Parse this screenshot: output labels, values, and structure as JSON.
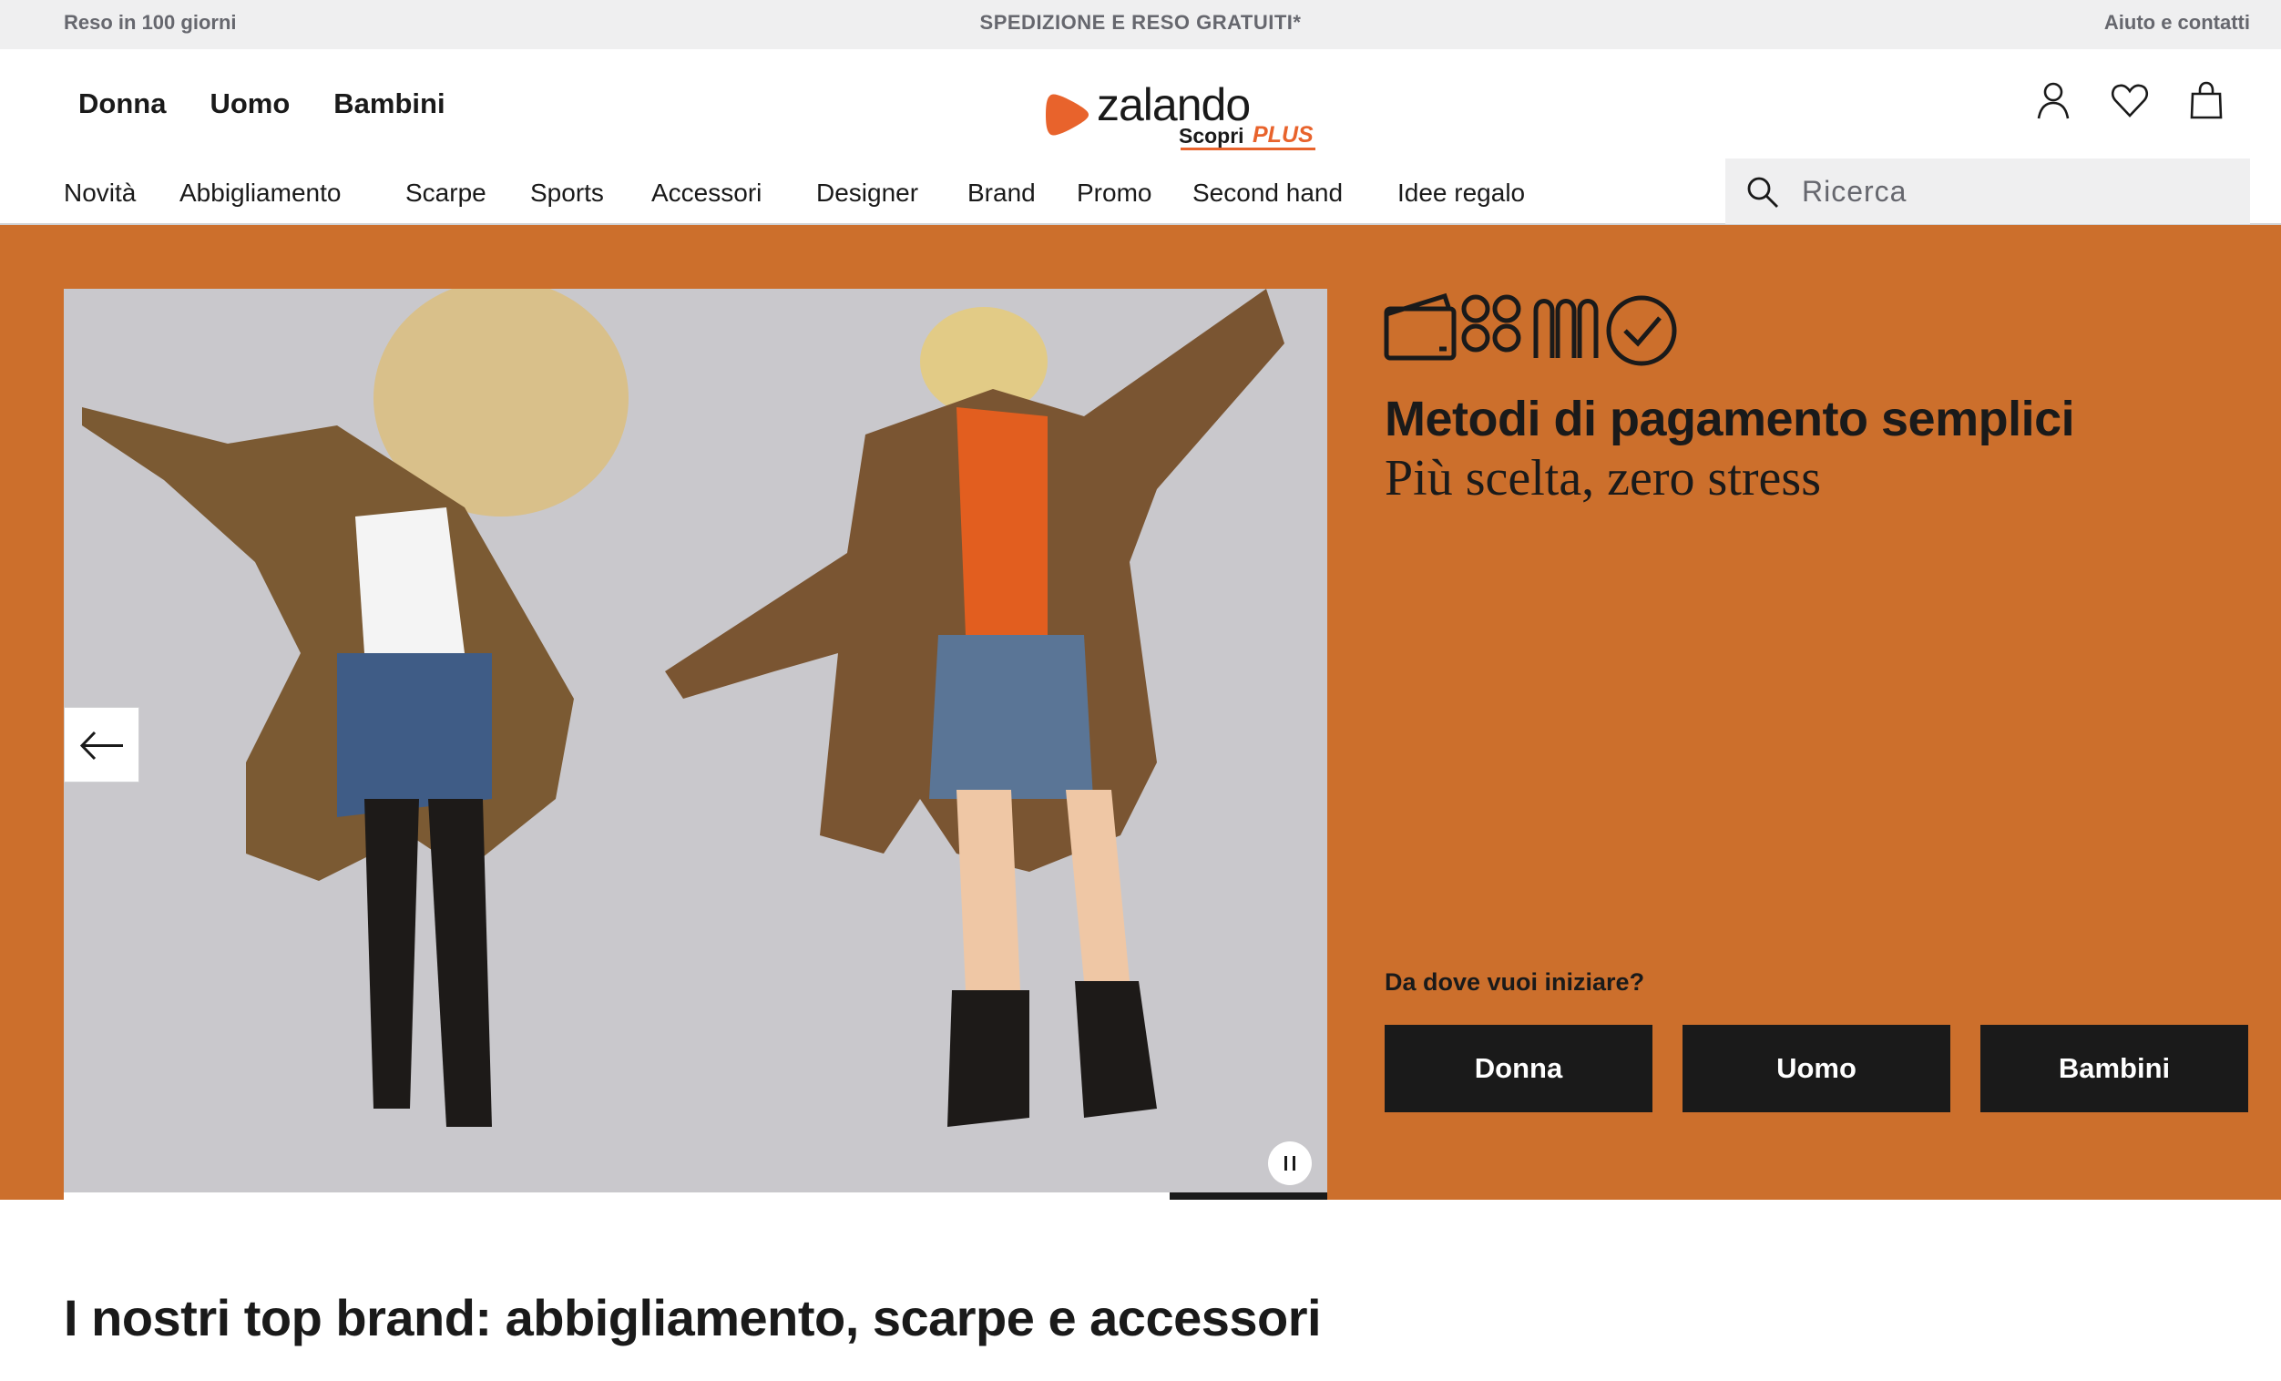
{
  "topbar": {
    "left": "Reso in 100 giorni",
    "center": "SPEDIZIONE E RESO GRATUITI*",
    "right": "Aiuto e contatti"
  },
  "gender_nav": [
    "Donna",
    "Uomo",
    "Bambini"
  ],
  "logo": {
    "text": "zalando",
    "sub": "Scopri",
    "plus": "PLUS",
    "brand_color": "#e8632c"
  },
  "header_icons": [
    "account-icon",
    "wishlist-heart-icon",
    "shopping-bag-icon"
  ],
  "category_nav": [
    "Novità",
    "Abbigliamento",
    "Scarpe",
    "Sports",
    "Accessori",
    "Designer",
    "Brand",
    "Promo",
    "Second hand",
    "Idee regalo"
  ],
  "search": {
    "placeholder": "Ricerca"
  },
  "hero": {
    "background": "#cc6f2c",
    "title": "Metodi di pagamento semplici",
    "subtitle": "Più scelta, zero stress",
    "question": "Da dove vuoi iniziare?",
    "ctas": [
      "Donna",
      "Uomo",
      "Bambini"
    ],
    "carousel_progress": 0.125,
    "icons": [
      "wallet-icon",
      "card-grid-icon",
      "installments-icon",
      "checkmark-circle-icon"
    ]
  },
  "section": {
    "title": "I nostri top brand: abbigliamento, scarpe e accessori"
  }
}
